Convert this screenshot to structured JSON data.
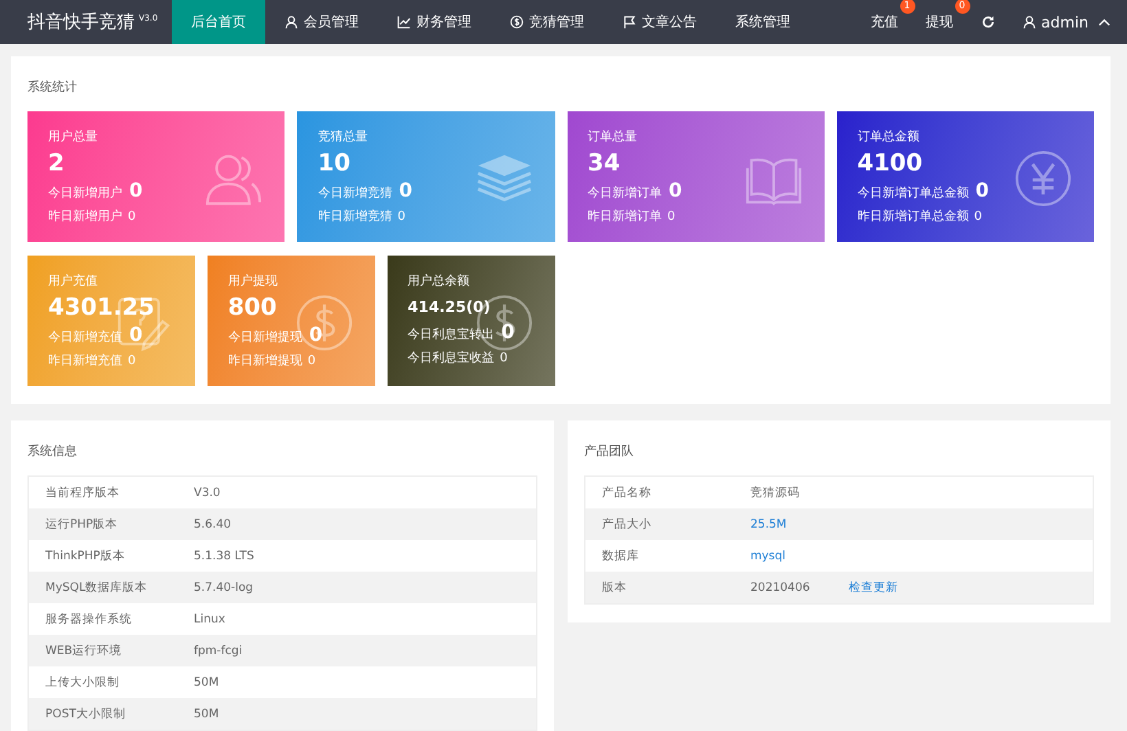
{
  "header": {
    "logo": "抖音快手竞猜",
    "version": "V3.0",
    "nav": [
      {
        "label": "后台首页",
        "kind": "plain",
        "selected": true
      },
      {
        "label": "会员管理",
        "kind": "user",
        "selected": false
      },
      {
        "label": "财务管理",
        "kind": "chart",
        "selected": false
      },
      {
        "label": "竞猜管理",
        "kind": "coin",
        "selected": false
      },
      {
        "label": "文章公告",
        "kind": "flag",
        "selected": false
      },
      {
        "label": "系统管理",
        "kind": "plain",
        "selected": false
      }
    ],
    "actions": [
      {
        "label": "充值",
        "badge": "1"
      },
      {
        "label": "提现",
        "badge": "0"
      }
    ],
    "user": "admin"
  },
  "stats": {
    "title": "系统统计",
    "cards": [
      {
        "title": "用户总量",
        "value": "2",
        "today_label": "今日新增用户",
        "today": "0",
        "yesterday_label": "昨日新增用户",
        "yesterday": "0",
        "kind": "users",
        "color": "#fc3a8f"
      },
      {
        "title": "竞猜总量",
        "value": "10",
        "today_label": "今日新增竞猜",
        "today": "0",
        "yesterday_label": "昨日新增竞猜",
        "yesterday": "0",
        "kind": "layers",
        "color": "#2a95e0"
      },
      {
        "title": "订单总量",
        "value": "34",
        "today_label": "今日新增订单",
        "today": "0",
        "yesterday_label": "昨日新增订单",
        "yesterday": "0",
        "kind": "book",
        "color": "#a048d0"
      },
      {
        "title": "订单总金额",
        "value": "4100",
        "today_label": "今日新增订单总金额",
        "today": "0",
        "yesterday_label": "昨日新增订单总金额",
        "yesterday": "0",
        "kind": "yen",
        "color": "#2a20cc"
      },
      {
        "title": "用户充值",
        "value": "4301.25",
        "today_label": "今日新增充值",
        "today": "0",
        "yesterday_label": "昨日新增充值",
        "yesterday": "0",
        "kind": "note",
        "color": "#f0a020"
      },
      {
        "title": "用户提现",
        "value": "800",
        "today_label": "今日新增提现",
        "today": "0",
        "yesterday_label": "昨日新增提现",
        "yesterday": "0",
        "kind": "dollar",
        "color": "#f08020"
      },
      {
        "title": "用户总余额",
        "value": "414.25(0)",
        "today_label": "今日利息宝转出",
        "today": "0",
        "yesterday_label": "今日利息宝收益",
        "yesterday": "0",
        "kind": "dollar",
        "color": "#3a3a1a"
      }
    ]
  },
  "system_info": {
    "title": "系统信息",
    "rows": [
      {
        "label": "当前程序版本",
        "value": "V3.0",
        "link": false
      },
      {
        "label": "运行PHP版本",
        "value": "5.6.40",
        "link": false
      },
      {
        "label": "ThinkPHP版本",
        "value": "5.1.38 LTS",
        "link": false
      },
      {
        "label": "MySQL数据库版本",
        "value": "5.7.40-log",
        "link": false
      },
      {
        "label": "服务器操作系统",
        "value": "Linux",
        "link": false
      },
      {
        "label": "WEB运行环境",
        "value": "fpm-fcgi",
        "link": false
      },
      {
        "label": "上传大小限制",
        "value": "50M",
        "link": false
      },
      {
        "label": "POST大小限制",
        "value": "50M",
        "link": false
      }
    ]
  },
  "product_team": {
    "title": "产品团队",
    "rows": [
      {
        "label": "产品名称",
        "value": "竞猜源码",
        "link": false
      },
      {
        "label": "产品大小",
        "value": "25.5M",
        "link": true
      },
      {
        "label": "数据库",
        "value": "mysql",
        "link": true
      },
      {
        "label": "版本",
        "value": "20210406",
        "link": false,
        "action": "检查更新"
      }
    ]
  }
}
